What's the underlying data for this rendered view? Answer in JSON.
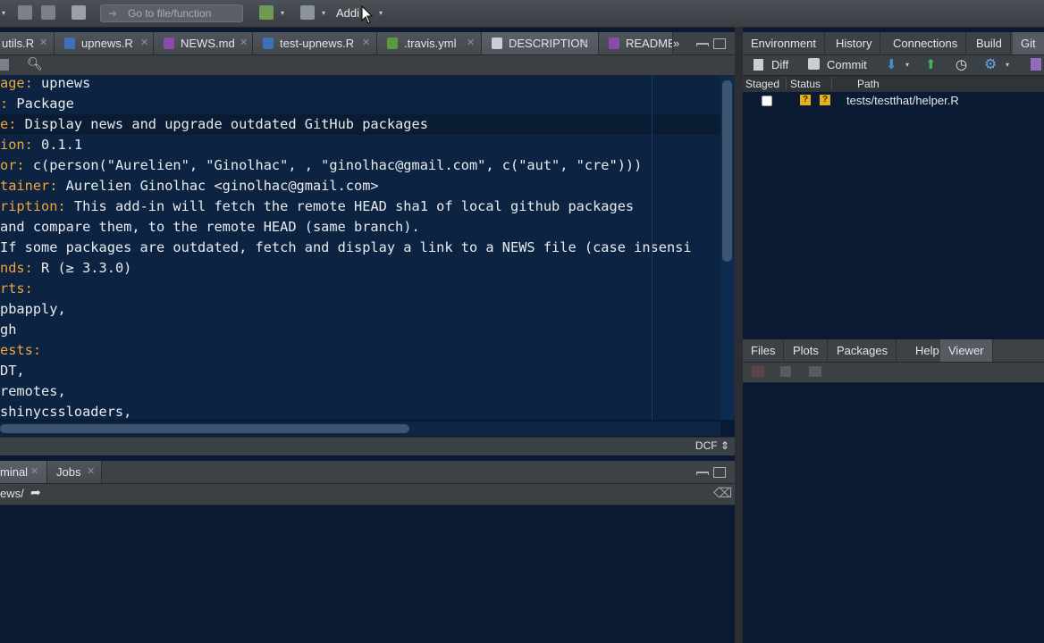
{
  "toolbar": {
    "goto_placeholder": "Go to file/function",
    "addins_label": "Addi"
  },
  "source_tabs": [
    {
      "label": "utils.R",
      "icon": "r-file-icon"
    },
    {
      "label": "upnews.R",
      "icon": "r-file-icon"
    },
    {
      "label": "NEWS.md",
      "icon": "md-file-icon"
    },
    {
      "label": "test-upnews.R",
      "icon": "r-file-icon"
    },
    {
      "label": ".travis.yml",
      "icon": "yml-file-icon"
    },
    {
      "label": "DESCRIPTION",
      "icon": "text-file-icon"
    },
    {
      "label": "README",
      "icon": "md-file-icon"
    }
  ],
  "editor": {
    "lines": [
      {
        "key": "age:",
        "rest": " upnews"
      },
      {
        "key": ":",
        "rest": " Package"
      },
      {
        "key": "e:",
        "rest": " Display news and upgrade outdated GitHub packages"
      },
      {
        "key": "ion:",
        "rest": " 0.1.1"
      },
      {
        "key": "or:",
        "rest": " c(person(\"Aurelien\", \"Ginolhac\", , \"ginolhac@gmail.com\", c(\"aut\", \"cre\")))"
      },
      {
        "key": "tainer:",
        "rest": " Aurelien Ginolhac <ginolhac@gmail.com>"
      },
      {
        "key": "ription:",
        "rest": " This add-in will fetch the remote HEAD sha1 of local github packages"
      },
      {
        "key": "",
        "rest": "and compare them, to the remote HEAD (same branch)."
      },
      {
        "key": "",
        "rest": "If some packages are outdated, fetch and display a link to a NEWS file (case insensi"
      },
      {
        "key": "nds:",
        "rest": " R (≥ 3.3.0)"
      },
      {
        "key": "rts:",
        "rest": ""
      },
      {
        "key": "",
        "rest": "pbapply,"
      },
      {
        "key": "",
        "rest": "gh"
      },
      {
        "key": "ests:",
        "rest": ""
      },
      {
        "key": "",
        "rest": "DT,"
      },
      {
        "key": "",
        "rest": "remotes,"
      },
      {
        "key": "",
        "rest": "shinycssloaders,"
      }
    ],
    "file_type": "DCF"
  },
  "console_tabs": [
    {
      "label": "minal"
    },
    {
      "label": "Jobs"
    }
  ],
  "console_path": "ews/",
  "env_tabs": [
    {
      "label": "Environment"
    },
    {
      "label": "History"
    },
    {
      "label": "Connections"
    },
    {
      "label": "Build"
    },
    {
      "label": "Git"
    }
  ],
  "git_toolbar": {
    "diff_label": "Diff",
    "commit_label": "Commit"
  },
  "git_table": {
    "headers": [
      "Staged",
      "Status",
      "Path"
    ],
    "rows": [
      {
        "staged": false,
        "status": [
          "?",
          "?"
        ],
        "path": "tests/testthat/helper.R"
      }
    ]
  },
  "files_tabs": [
    {
      "label": "Files"
    },
    {
      "label": "Plots"
    },
    {
      "label": "Packages"
    },
    {
      "label": "Help"
    },
    {
      "label": "Viewer"
    }
  ],
  "colors": {
    "editor_bg": "#0c2341",
    "keyword": "#f0a53b",
    "chrome": "#3d4247",
    "status_badge": "#e3b11a"
  }
}
